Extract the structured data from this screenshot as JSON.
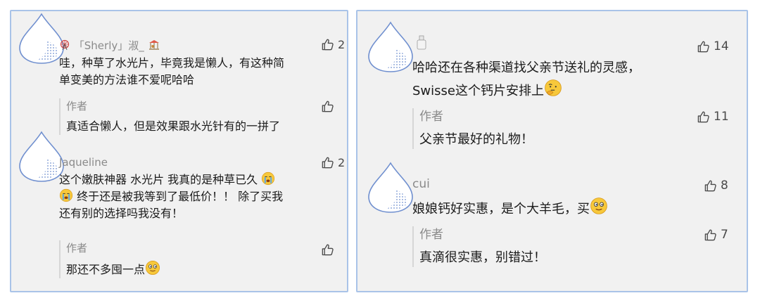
{
  "colors": {
    "panel_bg": "#f1f1f1",
    "panel_border": "#a9c3e8",
    "muted_text": "#8a8a8a",
    "main_text": "#1b1b1b"
  },
  "left_panel": {
    "comments": [
      {
        "name": "「Sherly」淑_",
        "likes": "2",
        "text_lines": [
          "哇，种草了水光片，毕竟我是懒人，有这种简",
          "单变美的方法谁不爱呢哈哈"
        ],
        "reply": {
          "author": "作者",
          "text": "真适合懒人，但是效果跟水光针有的一拼了",
          "likes": ""
        }
      },
      {
        "name": "Jaqueline",
        "likes": "2",
        "text_lines": [
          "这个嫩肤神器 水光片 我真的是种草已久",
          "终于还是被我等到了最低价！！ 除了买我",
          "还有别的选择吗我没有！"
        ],
        "reply": {
          "author": "作者",
          "text": "那还不多囤一点",
          "likes": ""
        }
      }
    ]
  },
  "right_panel": {
    "comments": [
      {
        "name": "",
        "likes": "14",
        "text_lines": [
          "哈哈还在各种渠道找父亲节送礼的灵感，",
          "Swisse这个钙片安排上"
        ],
        "reply": {
          "author": "作者",
          "text": "父亲节最好的礼物！",
          "likes": "11"
        }
      },
      {
        "name": "cui",
        "likes": "8",
        "text_lines": [
          "娘娘钙好实惠，是个大羊毛，买"
        ],
        "reply": {
          "author": "作者",
          "text": "真滴很实惠，别错过！",
          "likes": "7"
        }
      }
    ]
  }
}
